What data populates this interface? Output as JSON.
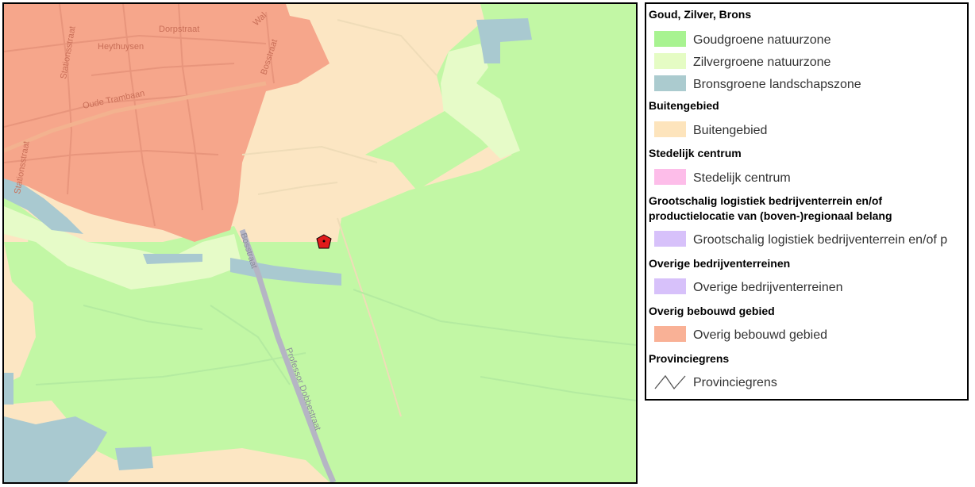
{
  "map": {
    "place_labels": [
      "Heythuysen",
      "Dorpstraat",
      "Wal",
      "Stationsstraat",
      "Oude Trambaan",
      "Bosstraat",
      "Bosstraat",
      "Stationsstraat",
      "Professor Dobbestraat"
    ],
    "marker_icon": "location-marker-icon",
    "colors": {
      "goud": "#c2f7a5",
      "zilver": "#e6fbc8",
      "brons": "#a9c9d0",
      "buiten": "#fce6c3",
      "bebouwd": "#f6a68b",
      "road": "#b5b5c4",
      "marker": "#e01b1b"
    }
  },
  "legend": {
    "groups": [
      {
        "header": "Goud, Zilver, Brons",
        "items": [
          {
            "label": "Goudgroene natuurzone",
            "color": "#a8f391"
          },
          {
            "label": "Zilvergroene natuurzone",
            "color": "#e5fcc4"
          },
          {
            "label": "Bronsgroene landschapszone",
            "color": "#abcbcf"
          }
        ]
      },
      {
        "header": "Buitengebied",
        "items": [
          {
            "label": "Buitengebied",
            "color": "#fde4bc"
          }
        ]
      },
      {
        "header": "Stedelijk centrum",
        "items": [
          {
            "label": "Stedelijk centrum",
            "color": "#fdbde9"
          }
        ]
      },
      {
        "header": "Grootschalig logistiek bedrijventerrein en/of productielocatie van (boven-)regionaal belang",
        "header_lines": [
          "Grootschalig logistiek bedrijventerrein en/of",
          "productielocatie van (boven-)regionaal belang"
        ],
        "items": [
          {
            "label": "Grootschalig logistiek bedrijventerrein en/of p",
            "color": "#d7c1fa"
          }
        ]
      },
      {
        "header": "Overige bedrijventerreinen",
        "items": [
          {
            "label": "Overige bedrijventerreinen",
            "color": "#d7c1fa"
          }
        ]
      },
      {
        "header": "Overig bebouwd gebied",
        "items": [
          {
            "label": "Overig bebouwd gebied",
            "color": "#f9b196"
          }
        ]
      },
      {
        "header": "Provinciegrens",
        "items": [
          {
            "label": "Provinciegrens",
            "icon": "boundary-line-icon"
          }
        ]
      }
    ]
  }
}
